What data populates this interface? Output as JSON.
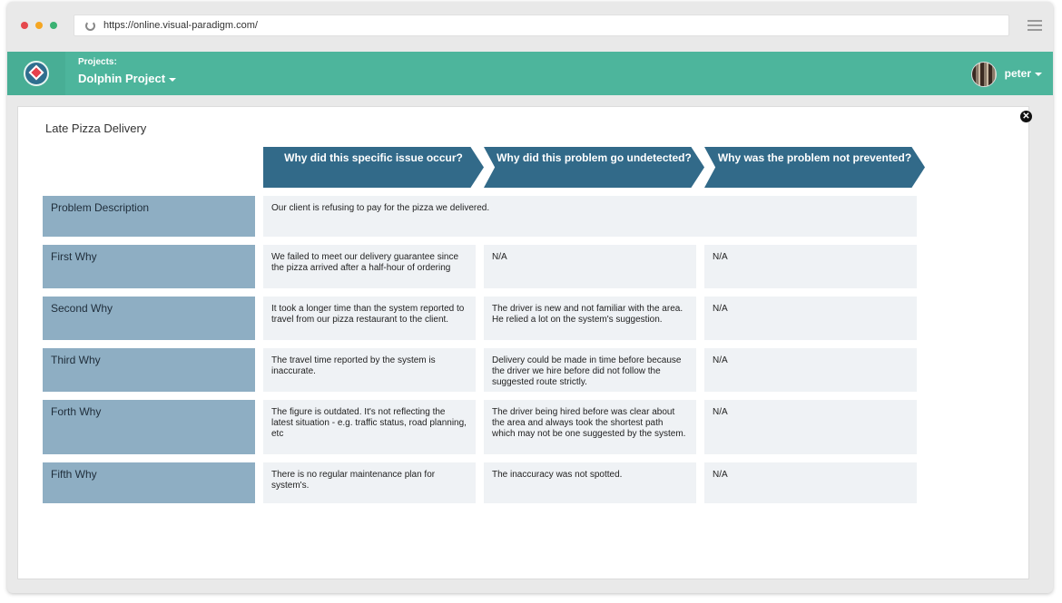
{
  "browser": {
    "url": "https://online.visual-paradigm.com/"
  },
  "appbar": {
    "projects_label": "Projects:",
    "project_name": "Dolphin Project",
    "user_name": "peter"
  },
  "diagram": {
    "title": "Late Pizza Delivery",
    "columns": [
      "Why did this specific issue occur?",
      "Why did this problem go undetected?",
      "Why was the problem not prevented?"
    ],
    "problem": {
      "label": "Problem Description",
      "text": "Our client is refusing to pay for the pizza we delivered."
    },
    "rows": [
      {
        "label": "First Why",
        "cells": [
          "We failed to meet our delivery guarantee since the pizza arrived after a half-hour of ordering",
          "N/A",
          "N/A"
        ]
      },
      {
        "label": "Second Why",
        "cells": [
          "It took a longer time than the system reported to travel from our pizza restaurant to the client.",
          "The driver is new and not familiar with the area. He relied a lot on the system's suggestion.",
          "N/A"
        ]
      },
      {
        "label": "Third Why",
        "cells": [
          "The travel time reported by the system is inaccurate.",
          "Delivery could be made in time before because the driver we hire before did not follow the suggested route strictly.",
          "N/A"
        ]
      },
      {
        "label": "Forth Why",
        "cells": [
          "The figure is outdated. It's not reflecting the latest situation - e.g. traffic status, road planning, etc",
          "The driver being hired before was clear about the area and always took the shortest path which may not be one suggested by the system.",
          "N/A"
        ]
      },
      {
        "label": "Fifth Why",
        "cells": [
          "There is no regular maintenance plan for system's.",
          "The inaccuracy was not spotted.",
          "N/A"
        ]
      }
    ]
  },
  "colors": {
    "appbar": "#4db59c",
    "header_arrow": "#326a89",
    "row_label": "#8eaec3",
    "cell": "#eff2f5"
  }
}
